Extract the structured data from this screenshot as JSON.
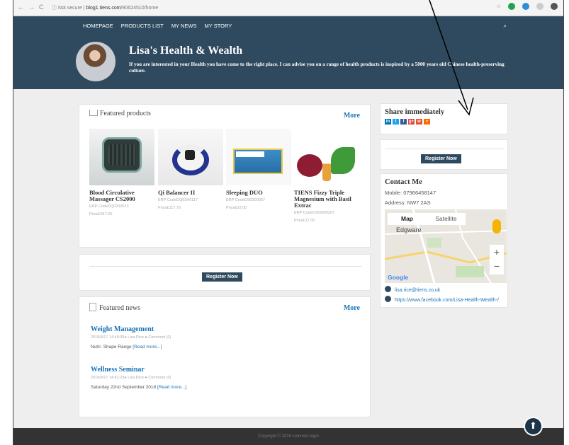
{
  "browser": {
    "back": "←",
    "forward": "→",
    "reload": "C",
    "security": "ⓘ Not secure",
    "url_host": "blog1.tiens.com",
    "url_path": "/90624510/home",
    "star": "☆"
  },
  "nav": {
    "items": [
      "HOMEPAGE",
      "PRODUCTS LIST",
      "MY NEWS",
      "MY STORY"
    ],
    "search_icon": "⌕"
  },
  "header": {
    "title": "Lisa's Health & Wealth",
    "subtitle": "If you are interested in your Health you have come to the right place. I can advise you on a range of health products is inspired by a 5000 years old Chinese health-preserving culture."
  },
  "featured_products": {
    "title": "Featured products",
    "more": "More",
    "items": [
      {
        "name": "Blood Circulative Massager CS2000",
        "code": "ERP CodeDQ0200023",
        "price": "Price£647.00",
        "icon": "massager-image"
      },
      {
        "name": "Qi Balancer II",
        "code": "ERP CodeDQ02H0117",
        "price": "Price£117.75",
        "icon": "qi-balancer-image"
      },
      {
        "name": "Sleeping DUO",
        "code": "ERP CodeDS0200057",
        "price": "Price£22.00",
        "icon": "sleeping-duo-image"
      },
      {
        "name": "TIENS Fizzy Triple Magnesium with Basil Extrac",
        "code": "ERP CodeDS02W0207",
        "price": "Price£17.00",
        "icon": "fizzy-magnesium-image"
      }
    ]
  },
  "register_button": "Register Now",
  "featured_news": {
    "title": "Featured news",
    "more": "More",
    "items": [
      {
        "title": "Weight Management",
        "meta": "2018/9/17 14:48:35● Lisa Rice ● Comment (0)",
        "text": "Nutri- Shape Range",
        "read_more": "[Read more...]"
      },
      {
        "title": "Wellness Seminar",
        "meta": "2018/9/17 14:41:29● Lisa Rice ● Comment (0)",
        "text": "Saturday 22nd September 2018",
        "read_more": "[Read more...]"
      }
    ]
  },
  "share": {
    "title": "Share immediately",
    "icons": [
      {
        "label": "in",
        "color": "#0077b5"
      },
      {
        "label": "t",
        "color": "#1da1f2"
      },
      {
        "label": "f",
        "color": "#3b5998"
      },
      {
        "label": "g+",
        "color": "#dd4b39"
      },
      {
        "label": "w",
        "color": "#e4523c"
      },
      {
        "label": "+",
        "color": "#ff6a00"
      }
    ]
  },
  "register_side": "Register Now",
  "contact": {
    "title": "Contact Me",
    "mobile": "Mobile: 07966458147",
    "address": "Address: NW7 2AS",
    "map_tab": "Map",
    "satellite_tab": "Satellite",
    "map_place": "Edgware",
    "zoom_in": "+",
    "zoom_out": "−",
    "map_brand": "Google",
    "email": "lisa.rice@tiens.co.uk",
    "facebook": "https://www.facebook.com/Lisa-Health-Wealth-/"
  },
  "footer": "Copyright © 2018 common.login",
  "back_to_top": "⬆"
}
